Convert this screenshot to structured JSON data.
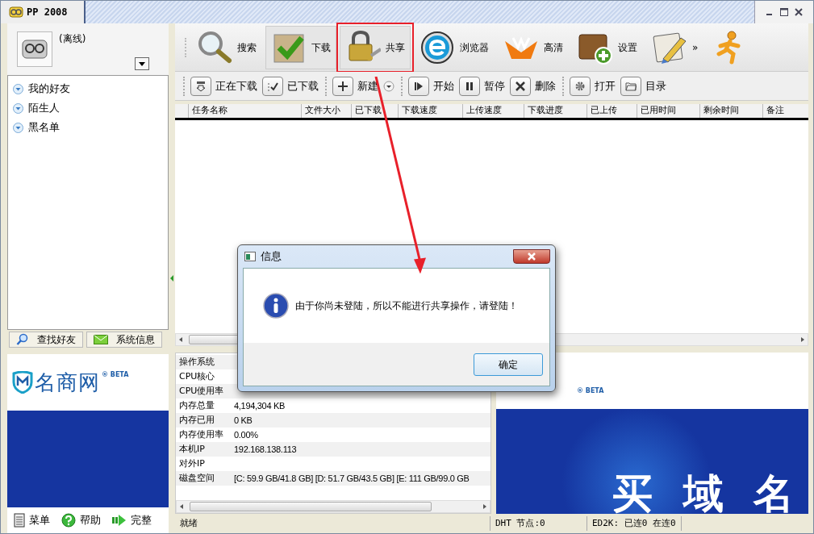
{
  "window": {
    "title": "PP 2008"
  },
  "profile": {
    "status": "(离线)"
  },
  "groups": [
    {
      "label": "我的好友"
    },
    {
      "label": "陌生人"
    },
    {
      "label": "黑名单"
    }
  ],
  "left_tabs": [
    {
      "label": "查找好友",
      "kind": "search"
    },
    {
      "label": "系统信息",
      "kind": "mail"
    }
  ],
  "left_ad": {
    "brand": "名商网",
    "badge": "® BETA"
  },
  "bottom_buttons": [
    {
      "label": "菜单",
      "kind": "menu"
    },
    {
      "label": "帮助",
      "kind": "help"
    },
    {
      "label": "完整",
      "kind": "full"
    }
  ],
  "tools": [
    {
      "label": "搜索",
      "kind": "search",
      "pressed": false,
      "highlighted": false
    },
    {
      "label": "下载",
      "kind": "download",
      "pressed": true,
      "highlighted": false
    },
    {
      "label": "共享",
      "kind": "share",
      "pressed": true,
      "highlighted": true
    },
    {
      "label": "浏览器",
      "kind": "browser",
      "pressed": false,
      "highlighted": false
    },
    {
      "label": "高清",
      "kind": "hd",
      "pressed": false,
      "highlighted": false
    },
    {
      "label": "设置",
      "kind": "settings",
      "pressed": false,
      "highlighted": false
    },
    {
      "label": "»",
      "kind": "notes",
      "pressed": false,
      "highlighted": false
    },
    {
      "kind": "runner",
      "pressed": false,
      "highlighted": false
    }
  ],
  "task_tools": [
    {
      "label": "正在下载",
      "kind": "downloading",
      "separator_before": true
    },
    {
      "label": "已下载",
      "kind": "downloaded",
      "separator_before": false
    },
    {
      "label": "新建",
      "kind": "new",
      "separator_before": true
    },
    {
      "label": "开始",
      "kind": "start",
      "separator_before": true
    },
    {
      "label": "暂停",
      "kind": "pause",
      "separator_before": false
    },
    {
      "label": "删除",
      "kind": "delete",
      "separator_before": false
    },
    {
      "label": "打开",
      "kind": "open",
      "separator_before": true
    },
    {
      "label": "目录",
      "kind": "folder",
      "separator_before": false
    }
  ],
  "task_table": {
    "columns": [
      "任务名称",
      "文件大小",
      "已下载",
      "下载速度",
      "上传速度",
      "下载进度",
      "已上传",
      "已用时间",
      "剩余时间",
      "备注"
    ]
  },
  "system_info": {
    "rows": [
      {
        "label": "操作系统"
      },
      {
        "label": "CPU核心"
      },
      {
        "label": "CPU使用率"
      },
      {
        "label": "内存总量",
        "value": "4,194,304 KB"
      },
      {
        "label": "内存已用",
        "value": "0 KB"
      },
      {
        "label": "内存使用率",
        "value": "0.00%"
      },
      {
        "label": "本机IP",
        "value": "192.168.138.113"
      },
      {
        "label": "对外IP"
      },
      {
        "label": "磁盘空间",
        "value": "[C: 59.9 GB/41.8 GB] [D: 51.7 GB/43.5 GB] [E: 111 GB/99.0 GB"
      }
    ]
  },
  "right_ad": {
    "badge": "® BETA",
    "slogan": "买 域 名"
  },
  "status_bar": {
    "text": "就绪",
    "dht": "DHT 节点:0",
    "ed2k": "ED2K: 已连0 在连0"
  },
  "dialog": {
    "title": "信息",
    "message": "由于你尚未登陆，所以不能进行共享操作，请登陆！",
    "button": "确定"
  }
}
